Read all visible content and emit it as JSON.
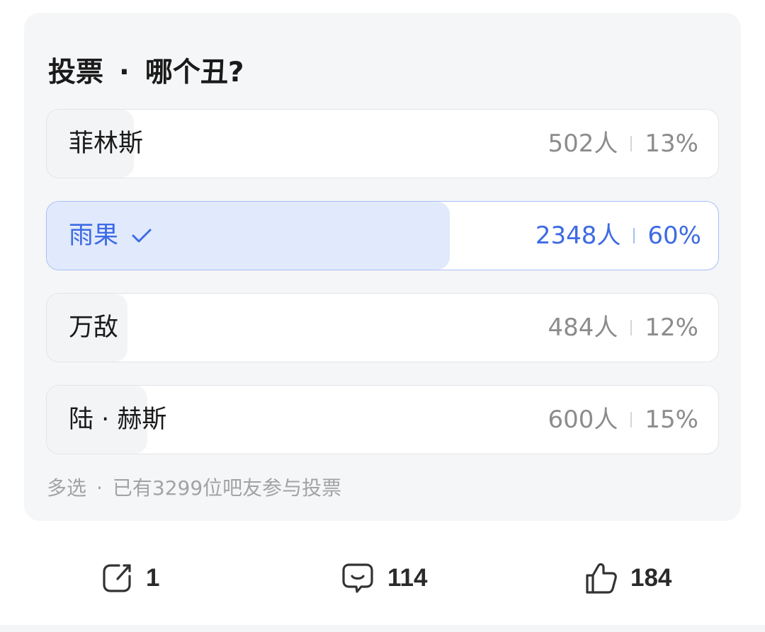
{
  "poll": {
    "title_prefix": "投票",
    "title_separator": "·",
    "question": "哪个丑?",
    "options": [
      {
        "label": "菲林斯",
        "count": "502人",
        "percent": "13%",
        "fraction": 0.13,
        "selected": false
      },
      {
        "label": "雨果",
        "count": "2348人",
        "percent": "60%",
        "fraction": 0.6,
        "selected": true
      },
      {
        "label": "万敌",
        "count": "484人",
        "percent": "12%",
        "fraction": 0.12,
        "selected": false
      },
      {
        "label": "陆 · 赫斯",
        "count": "600人",
        "percent": "15%",
        "fraction": 0.15,
        "selected": false
      }
    ],
    "footer_mode": "多选",
    "footer_separator": "·",
    "footer_summary": "已有3299位吧友参与投票"
  },
  "actions": {
    "share": {
      "icon": "share-icon",
      "count": "1"
    },
    "comment": {
      "icon": "comment-icon",
      "count": "114"
    },
    "like": {
      "icon": "thumbs-up-icon",
      "count": "184"
    }
  },
  "colors": {
    "accent": "#3d6be3",
    "selected_fill": "#e1e9fd",
    "unselected_fill": "#f3f4f6",
    "card_background": "#f5f6f8"
  }
}
